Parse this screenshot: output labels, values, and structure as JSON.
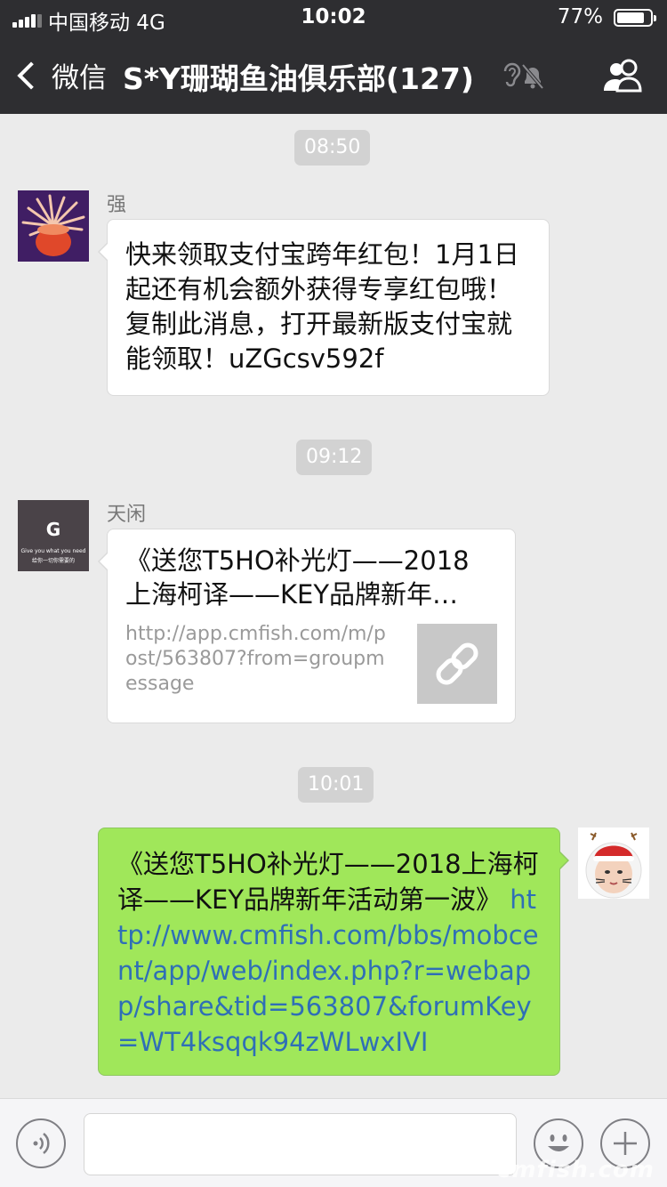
{
  "status_bar": {
    "carrier": "中国移动  4G",
    "time": "10:02",
    "battery": "77%"
  },
  "nav": {
    "back_label": "微信",
    "title": "S*Y珊瑚鱼油俱乐部(127)"
  },
  "messages": [
    {
      "timestamp": "08:50",
      "sender": "强",
      "text": "快来领取支付宝跨年红包！1月1日起还有机会额外获得专享红包哦！复制此消息，打开最新版支付宝就能领取！uZGcsv592f"
    },
    {
      "timestamp": "09:12",
      "sender": "天闲",
      "avatar_letter": "G",
      "avatar_line1": "Give you what you need",
      "avatar_line2": "给你一切你需要的",
      "card_title_line1": "《送您T5HO补光灯——2018",
      "card_title_line2": "上海柯译——KEY品牌新年…",
      "card_url": "http://app.cmfish.com/m/post/563807?from=groupmessage"
    },
    {
      "timestamp": "10:01",
      "text": "《送您T5HO补光灯——2018上海柯译——KEY品牌新年活动第一波》 ",
      "link": "http://www.cmfish.com/bbs/mobcent/app/web/index.php?r=webapp/share&tid=563807&forumKey=WT4ksqqk94zWLwxIVI"
    }
  ],
  "watermark": "cmfish.com",
  "colors": {
    "header": "#2e2e31",
    "background": "#ebebeb",
    "sent_bubble": "#a0e75a",
    "link": "#2f6fb6"
  },
  "icons": [
    "signal-icon",
    "battery-icon",
    "back-chevron-icon",
    "mute-icon",
    "group-members-icon",
    "link-icon",
    "voice-icon",
    "emoji-icon",
    "plus-icon"
  ]
}
